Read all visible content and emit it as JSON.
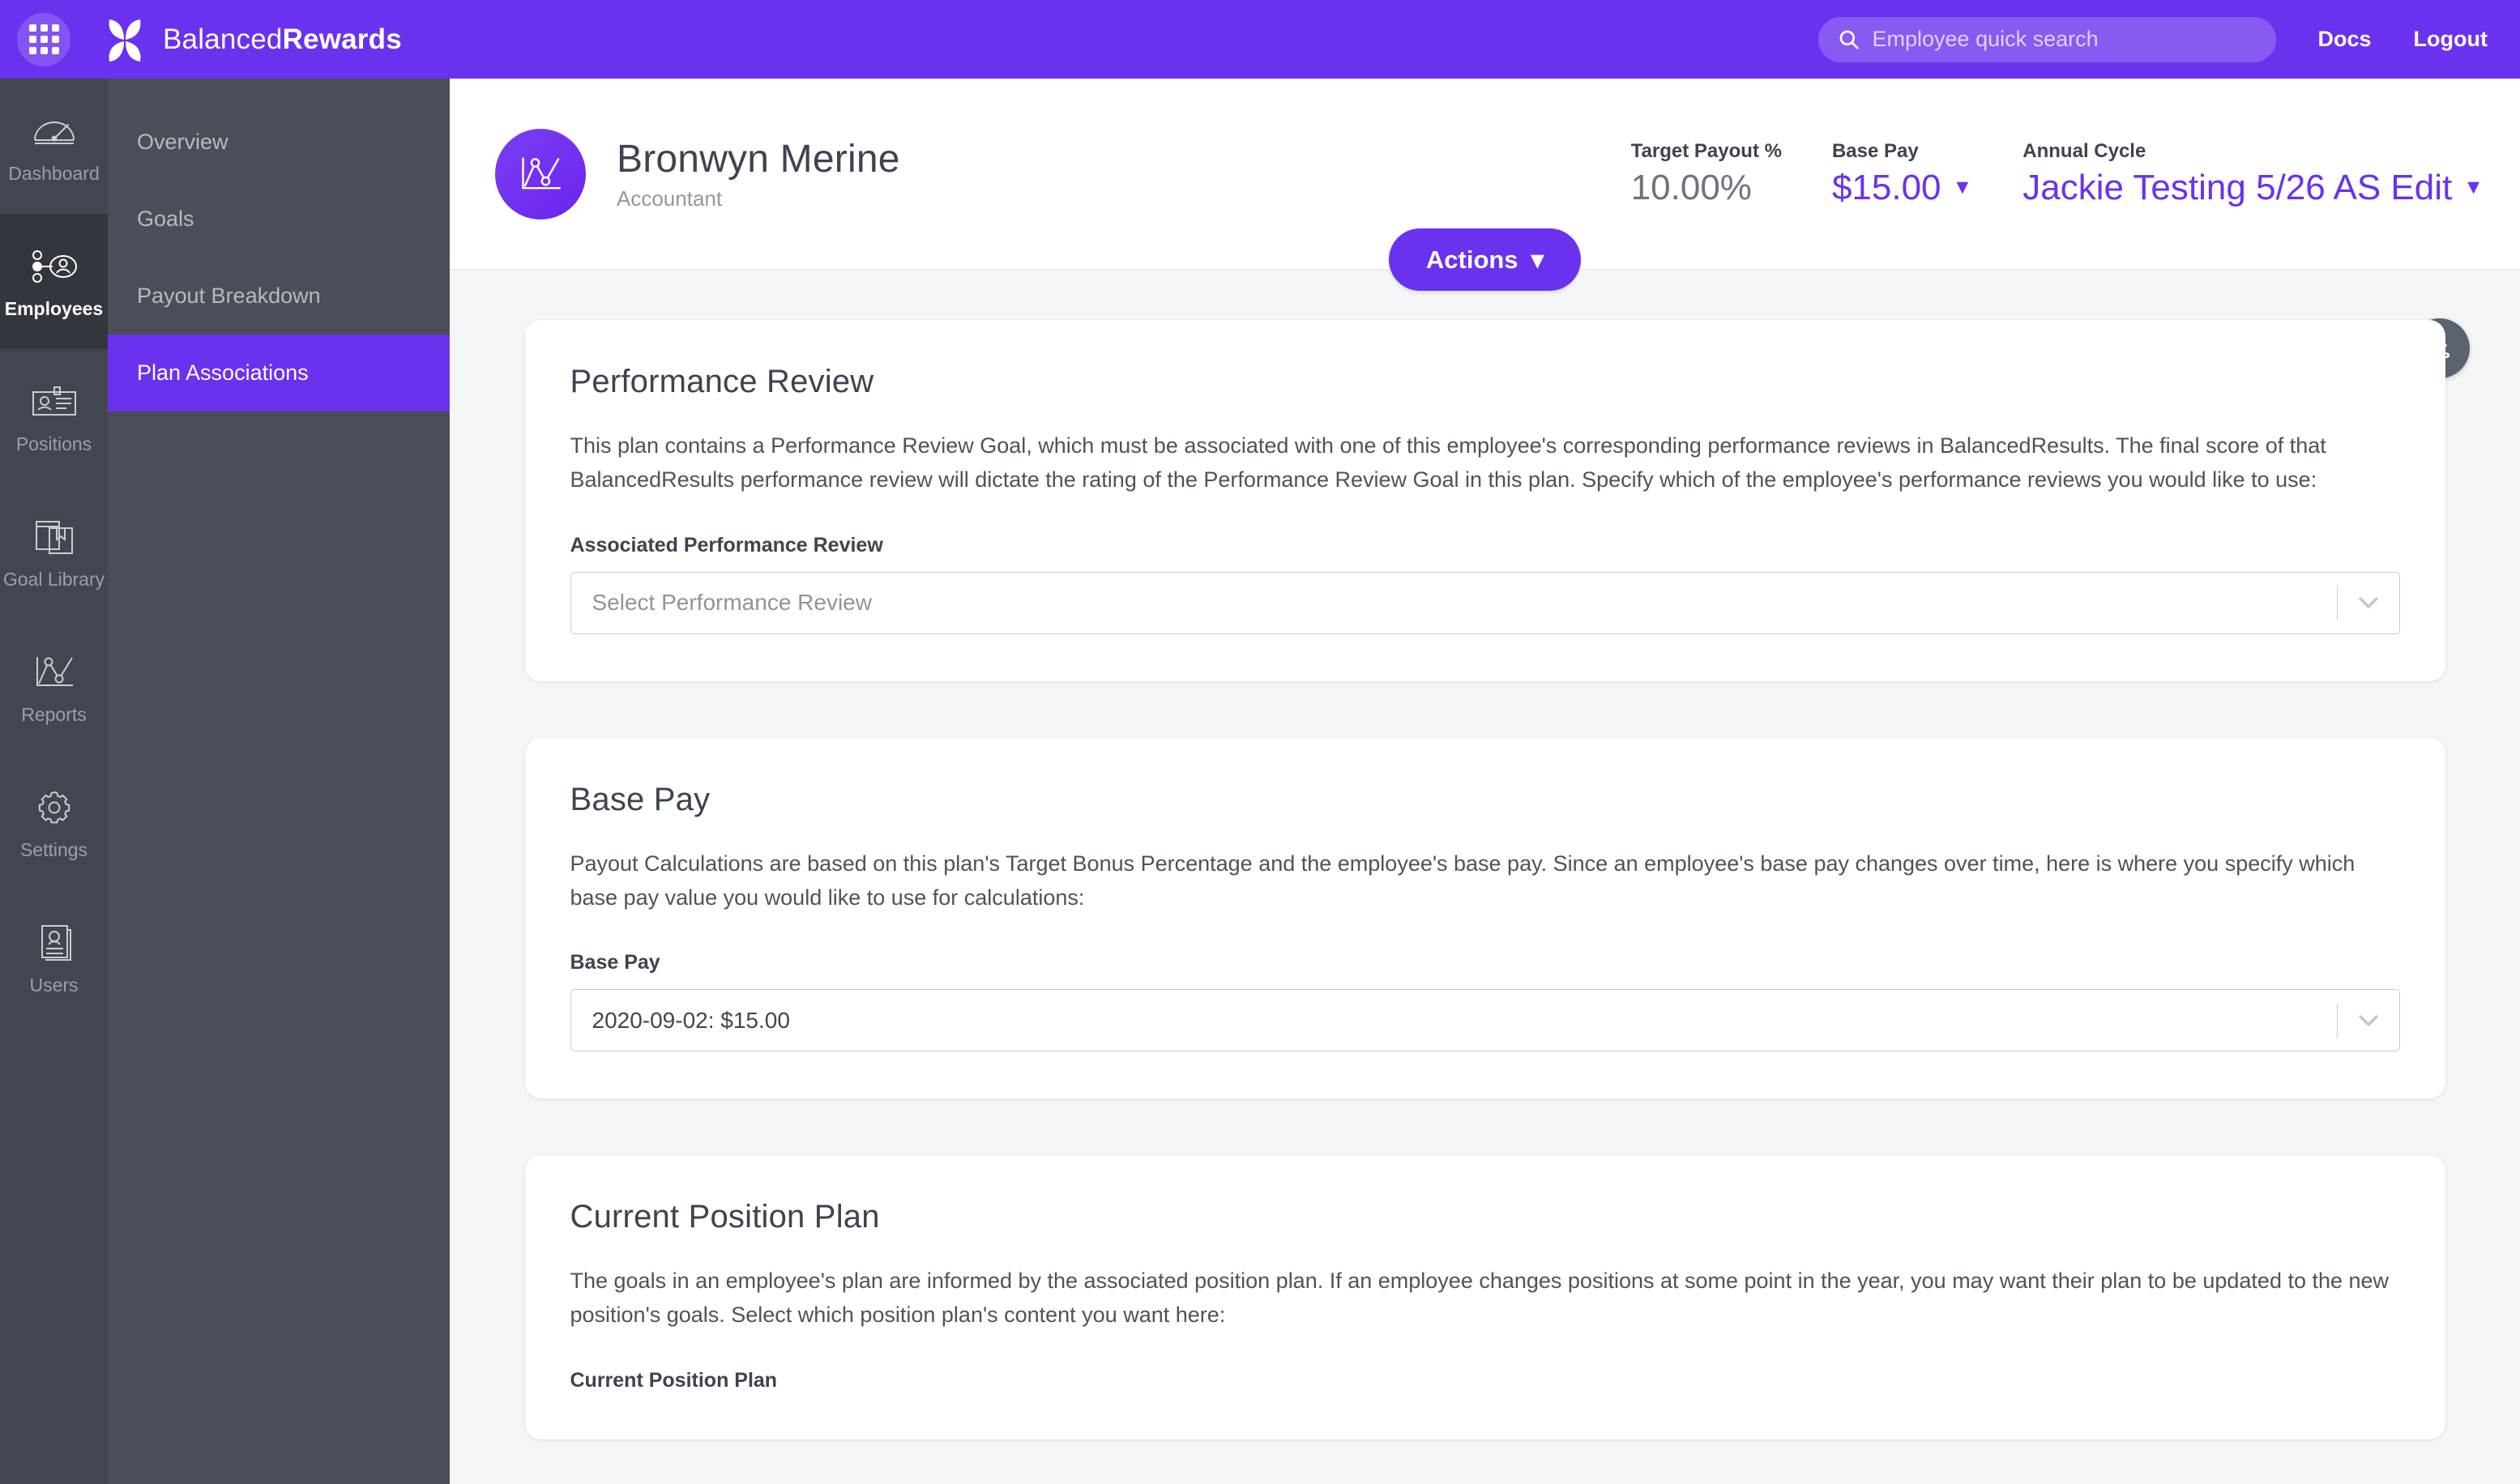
{
  "topbar": {
    "apps_icon": "apps-grid-icon",
    "brand_light": "Balanced",
    "brand_bold": "Rewards",
    "search": {
      "placeholder": "Employee quick search",
      "value": "",
      "icon": "search-icon"
    },
    "docs_label": "Docs",
    "logout_label": "Logout",
    "bg_color": "#6a32ef"
  },
  "rail": {
    "items": [
      {
        "label": "Dashboard",
        "icon": "speedometer-icon",
        "active": false
      },
      {
        "label": "Employees",
        "icon": "org-chart-person-icon",
        "active": true
      },
      {
        "label": "Positions",
        "icon": "id-badge-icon",
        "active": false
      },
      {
        "label": "Goal Library",
        "icon": "books-icon",
        "active": false
      },
      {
        "label": "Reports",
        "icon": "line-chart-icon",
        "active": false
      },
      {
        "label": "Settings",
        "icon": "gear-icon",
        "active": false
      },
      {
        "label": "Users",
        "icon": "user-documents-icon",
        "active": false
      }
    ]
  },
  "subnav": {
    "items": [
      {
        "label": "Overview",
        "active": false
      },
      {
        "label": "Goals",
        "active": false
      },
      {
        "label": "Payout Breakdown",
        "active": false
      },
      {
        "label": "Plan Associations",
        "active": true
      }
    ]
  },
  "employee": {
    "avatar_icon": "line-chart-avatar-icon",
    "name": "Bronwyn Merine",
    "title": "Accountant",
    "stats": [
      {
        "label": "Target Payout %",
        "value": "10.00%",
        "link": false,
        "caret": false
      },
      {
        "label": "Base Pay",
        "value": "$15.00",
        "link": true,
        "caret": true
      },
      {
        "label": "Annual Cycle",
        "value": "Jackie Testing 5/26 AS Edit",
        "link": true,
        "caret": true
      }
    ]
  },
  "actions_button": {
    "label": "Actions",
    "caret": "▾",
    "color": "#6a32ef"
  },
  "download_button": {
    "icon": "download-icon"
  },
  "cards": [
    {
      "title": "Performance Review",
      "body": "This plan contains a Performance Review Goal, which must be associated with one of this employee's corresponding performance reviews in BalancedResults. The final score of that BalancedResults performance review will dictate the rating of the Performance Review Goal in this plan. Specify which of the employee's performance reviews you would like to use:",
      "field_label": "Associated Performance Review",
      "select_value": "Select Performance Review",
      "is_placeholder": true
    },
    {
      "title": "Base Pay",
      "body": "Payout Calculations are based on this plan's Target Bonus Percentage and the employee's base pay. Since an employee's base pay changes over time, here is where you specify which base pay value you would like to use for calculations:",
      "field_label": "Base Pay",
      "select_value": "2020-09-02: $15.00",
      "is_placeholder": false
    },
    {
      "title": "Current Position Plan",
      "body": "The goals in an employee's plan are informed by the associated position plan. If an employee changes positions at some point in the year, you may want their plan to be updated to the new position's goals. Select which position plan's content you want here:",
      "field_label": "Current Position Plan",
      "select_value": "",
      "is_placeholder": true
    }
  ]
}
